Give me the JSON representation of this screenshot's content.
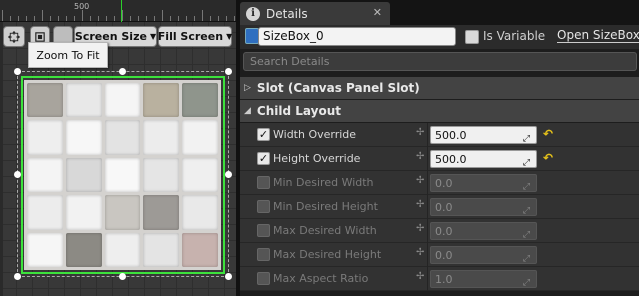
{
  "designer": {
    "ruler_label": "500",
    "toolbar": {
      "zoom_fit_icon": "zoom-to-fit-icon",
      "grid_icon": "grid-icon",
      "screen_size_label": "Screen Size",
      "fill_screen_label": "Fill Screen"
    },
    "tooltip": "Zoom To Fit",
    "mosaic_colors": [
      "#a8a49d",
      "#e8e8e8",
      "#f5f5f5",
      "#b9b19f",
      "#8f958c",
      "#eeeeee",
      "#f7f7f7",
      "#e3e3e3",
      "#ececec",
      "#f2f2f2",
      "#f4f4f4",
      "#d8d8d8",
      "#f8f8f8",
      "#e5e5e5",
      "#efefef",
      "#ececec",
      "#f2f2f2",
      "#c9c6c1",
      "#9d9a96",
      "#e9e9e9",
      "#f6f6f6",
      "#8c8a84",
      "#eeeeee",
      "#e4e4e4",
      "#c7b2ae"
    ]
  },
  "details": {
    "tab_label": "Details",
    "name_value": "SizeBox_0",
    "is_variable_label": "Is Variable",
    "open_link": "Open SizeBox",
    "search_placeholder": "Search Details",
    "categories": {
      "slot": "Slot (Canvas Panel Slot)",
      "child_layout": "Child Layout"
    },
    "properties": [
      {
        "label": "Width Override",
        "value": "500.0",
        "enabled": true,
        "checked": true
      },
      {
        "label": "Height Override",
        "value": "500.0",
        "enabled": true,
        "checked": true
      },
      {
        "label": "Min Desired Width",
        "value": "0.0",
        "enabled": false,
        "checked": false
      },
      {
        "label": "Min Desired Height",
        "value": "0.0",
        "enabled": false,
        "checked": false
      },
      {
        "label": "Max Desired Width",
        "value": "0.0",
        "enabled": false,
        "checked": false
      },
      {
        "label": "Max Desired Height",
        "value": "0.0",
        "enabled": false,
        "checked": false
      },
      {
        "label": "Max Aspect Ratio",
        "value": "1.0",
        "enabled": false,
        "checked": false
      }
    ]
  },
  "colors": {
    "selection_green": "#3ce23c",
    "reset_arrow": "#e6c21a"
  }
}
